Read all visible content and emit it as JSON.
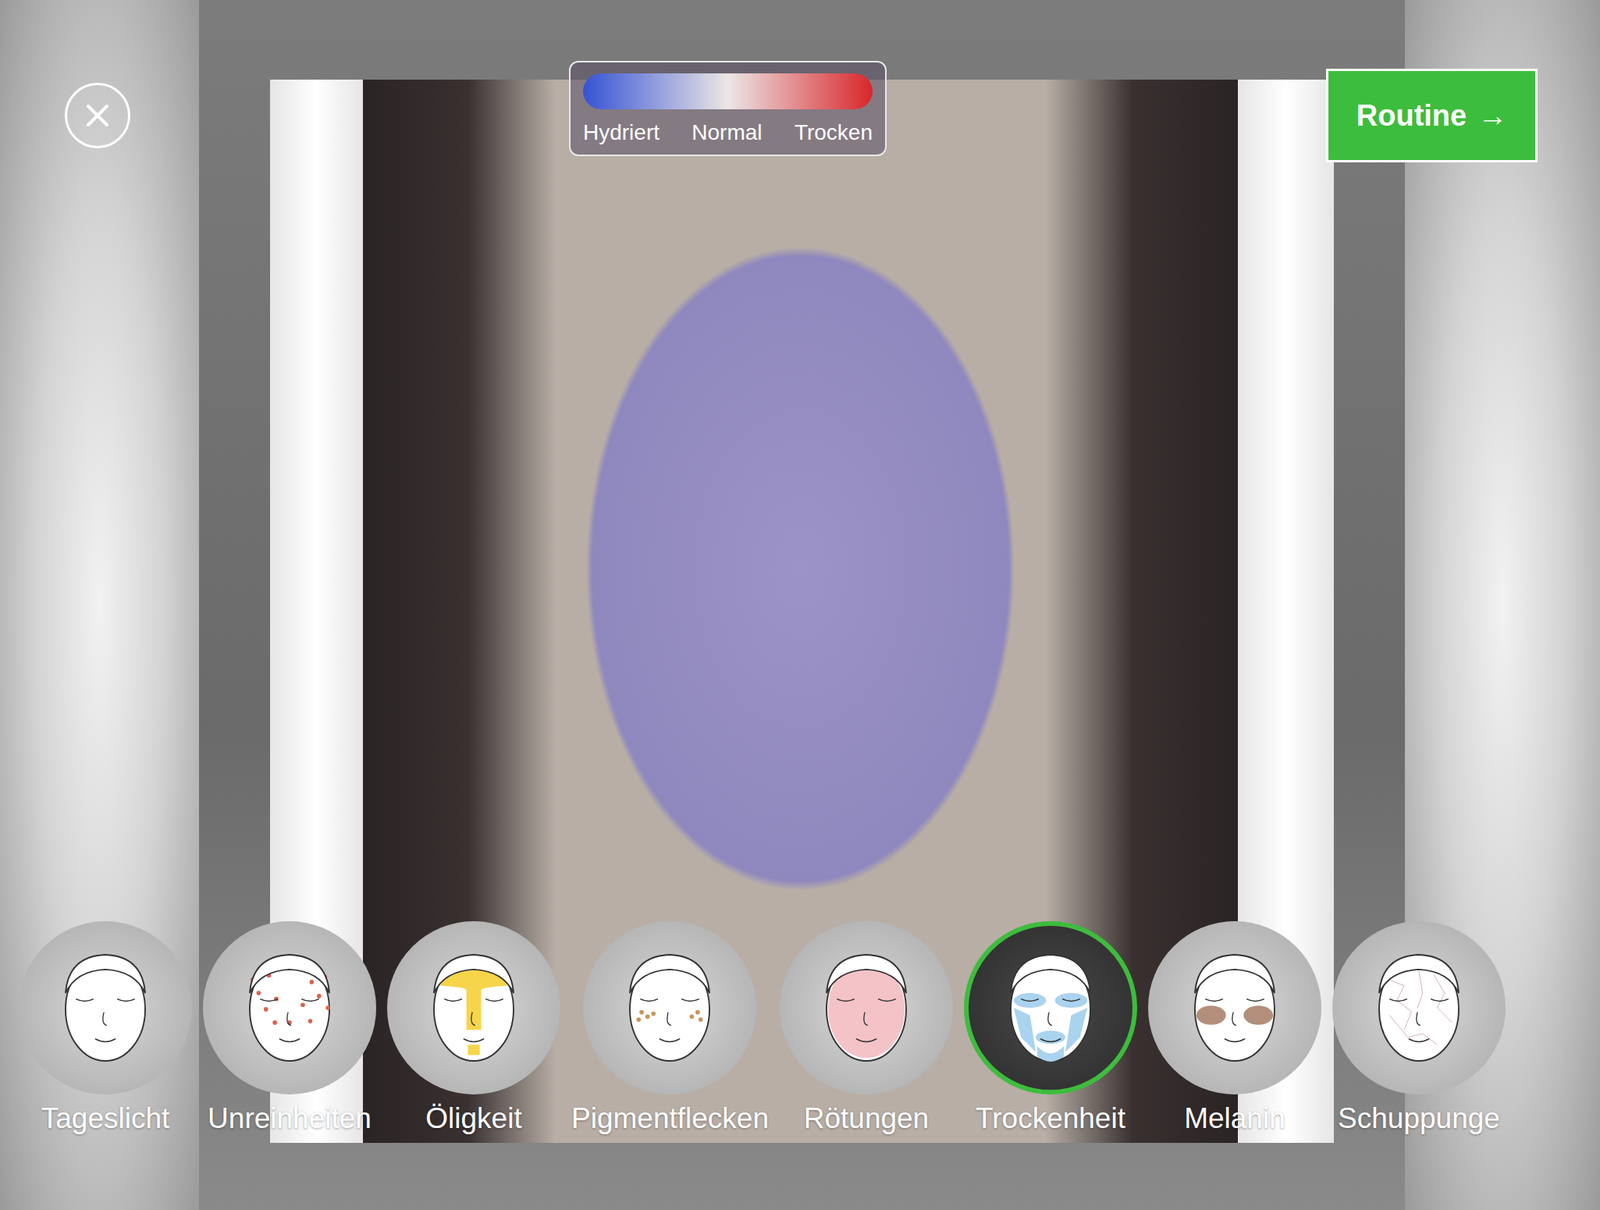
{
  "legend": {
    "labels": [
      "Hydriert",
      "Normal",
      "Trocken"
    ],
    "scale_colors": [
      "#3553d4",
      "#ece6e6",
      "#d8262b"
    ]
  },
  "routine_button": {
    "label": "Routine",
    "arrow": "→"
  },
  "filters": [
    {
      "label": "Tageslicht",
      "selected": false,
      "kind": "none",
      "color": "#ffffff"
    },
    {
      "label": "Unreinheiten",
      "selected": false,
      "kind": "dots",
      "color": "#d9654f"
    },
    {
      "label": "Öligkeit",
      "selected": false,
      "kind": "tzone",
      "color": "#f7d54a"
    },
    {
      "label": "Pigmentflecken",
      "selected": false,
      "kind": "spots",
      "color": "#c9955a"
    },
    {
      "label": "Rötungen",
      "selected": false,
      "kind": "full",
      "color": "#f3c3c8"
    },
    {
      "label": "Trockenheit",
      "selected": true,
      "kind": "zones",
      "color": "#a9d3ee"
    },
    {
      "label": "Melanin",
      "selected": false,
      "kind": "cheeks",
      "color": "#9a6a50"
    },
    {
      "label": "Schuppunge",
      "selected": false,
      "kind": "lines",
      "color": "#c79a9a"
    }
  ]
}
